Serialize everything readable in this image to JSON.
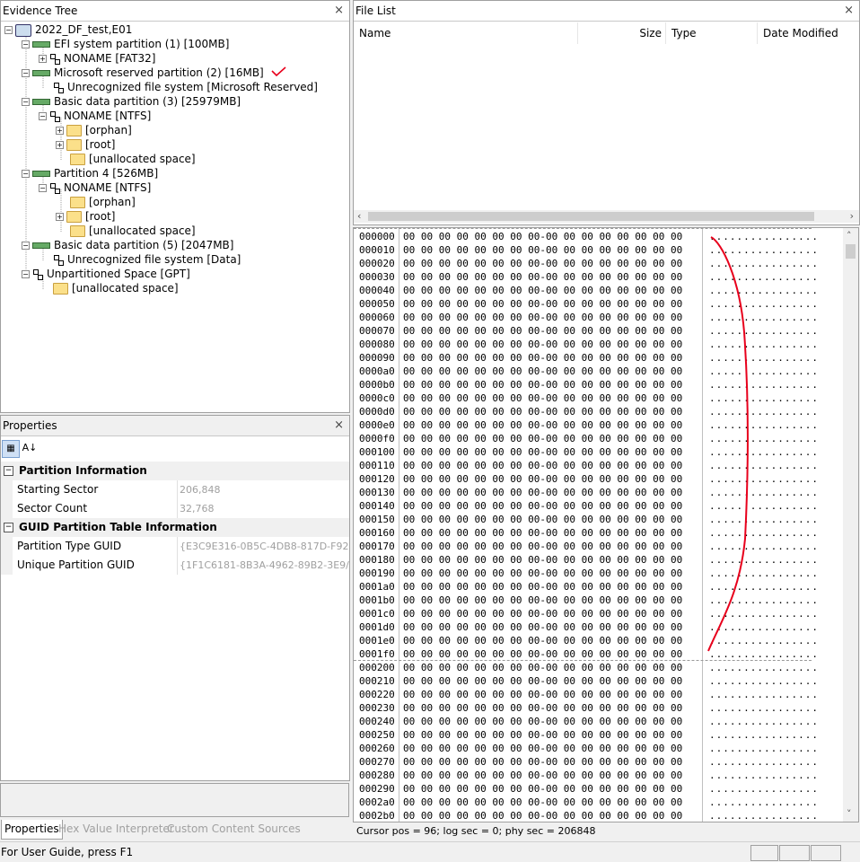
{
  "evidence_tree": {
    "title": "Evidence Tree",
    "items": [
      {
        "label": "2022_DF_test,E01"
      },
      {
        "label": "EFI system partition (1) [100MB]"
      },
      {
        "label": "NONAME [FAT32]"
      },
      {
        "label": "Microsoft reserved partition (2) [16MB]"
      },
      {
        "label": "Unrecognized file system [Microsoft Reserved]"
      },
      {
        "label": "Basic data partition (3) [25979MB]"
      },
      {
        "label": "NONAME [NTFS]"
      },
      {
        "label": "[orphan]"
      },
      {
        "label": "[root]"
      },
      {
        "label": "[unallocated space]"
      },
      {
        "label": "Partition 4 [526MB]"
      },
      {
        "label": "NONAME [NTFS]"
      },
      {
        "label": "[orphan]"
      },
      {
        "label": "[root]"
      },
      {
        "label": "[unallocated space]"
      },
      {
        "label": "Basic data partition (5) [2047MB]"
      },
      {
        "label": "Unrecognized file system [Data]"
      },
      {
        "label": "Unpartitioned Space [GPT]"
      },
      {
        "label": "[unallocated space]"
      }
    ]
  },
  "file_list": {
    "title": "File List",
    "columns": [
      "Name",
      "Size",
      "Type",
      "Date Modified"
    ]
  },
  "hex_view": {
    "offsets": [
      "000000",
      "000010",
      "000020",
      "000030",
      "000040",
      "000050",
      "000060",
      "000070",
      "000080",
      "000090",
      "0000a0",
      "0000b0",
      "0000c0",
      "0000d0",
      "0000e0",
      "0000f0",
      "000100",
      "000110",
      "000120",
      "000130",
      "000140",
      "000150",
      "000160",
      "000170",
      "000180",
      "000190",
      "0001a0",
      "0001b0",
      "0001c0",
      "0001d0",
      "0001e0",
      "0001f0",
      "000200",
      "000210",
      "000220",
      "000230",
      "000240",
      "000250",
      "000260",
      "000270",
      "000280",
      "000290",
      "0002a0",
      "0002b0"
    ],
    "bytes_row": "00 00 00 00 00 00 00 00-00 00 00 00 00 00 00 00",
    "ascii_row": "................",
    "status": "Cursor pos = 96; log sec = 0; phy sec = 206848"
  },
  "properties": {
    "title": "Properties",
    "sections": [
      {
        "title": "Partition Information",
        "rows": [
          {
            "key": "Starting Sector",
            "value": "206,848"
          },
          {
            "key": "Sector Count",
            "value": "32,768"
          }
        ]
      },
      {
        "title": "GUID Partition Table Information",
        "rows": [
          {
            "key": "Partition Type GUID",
            "value": "{E3C9E316-0B5C-4DB8-817D-F92"
          },
          {
            "key": "Unique Partition GUID",
            "value": "{1F1C6181-8B3A-4962-89B2-3E9/"
          }
        ]
      }
    ],
    "tabs": [
      "Properties",
      "Hex Value Interpreter",
      "Custom Content Sources"
    ]
  },
  "status_bar": {
    "text": "For User Guide, press F1"
  },
  "annotation_color": "#e8001c"
}
